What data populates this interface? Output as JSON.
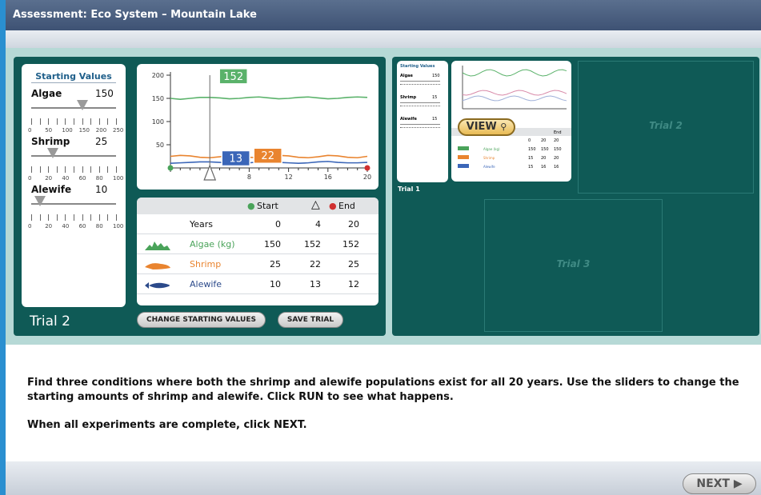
{
  "window": {
    "title": "Assessment: Eco System – Mountain Lake"
  },
  "starting_values": {
    "title": "Starting Values",
    "sliders": [
      {
        "label": "Algae",
        "value": "150",
        "ticks": [
          "0",
          "50",
          "100",
          "150",
          "200",
          "250"
        ],
        "fraction": 0.6
      },
      {
        "label": "Shrimp",
        "value": "25",
        "ticks": [
          "0",
          "20",
          "40",
          "60",
          "80",
          "100"
        ],
        "fraction": 0.25
      },
      {
        "label": "Alewife",
        "value": "10",
        "ticks": [
          "0",
          "20",
          "40",
          "60",
          "80",
          "100"
        ],
        "fraction": 0.1
      }
    ]
  },
  "trial_label": "Trial 2",
  "chart_data": {
    "type": "line",
    "x_ticks": [
      "4",
      "8",
      "12",
      "16",
      "20"
    ],
    "y_ticks": [
      "50",
      "100",
      "150",
      "200"
    ],
    "ylim": [
      0,
      200
    ],
    "xlim": [
      0,
      20
    ],
    "marker_labels": {
      "algae": "152",
      "shrimp": "22",
      "alewife": "13"
    },
    "marker_year": 4,
    "series": [
      {
        "color": "#5ab26a",
        "x": [
          0,
          1,
          2,
          3,
          4,
          5,
          6,
          7,
          8,
          9,
          10,
          11,
          12,
          13,
          14,
          15,
          16,
          17,
          18,
          19,
          20
        ],
        "y": [
          150,
          148,
          150,
          152,
          152,
          151,
          149,
          150,
          152,
          153,
          151,
          149,
          150,
          152,
          153,
          151,
          149,
          150,
          152,
          153,
          152
        ]
      },
      {
        "color": "#e9842f",
        "x": [
          0,
          1,
          2,
          3,
          4,
          5,
          6,
          7,
          8,
          9,
          10,
          11,
          12,
          13,
          14,
          15,
          16,
          17,
          18,
          19,
          20
        ],
        "y": [
          25,
          27,
          26,
          23,
          22,
          24,
          27,
          26,
          23,
          22,
          24,
          27,
          26,
          23,
          22,
          24,
          27,
          26,
          23,
          22,
          25
        ]
      },
      {
        "color": "#3b66b8",
        "x": [
          0,
          1,
          2,
          3,
          4,
          5,
          6,
          7,
          8,
          9,
          10,
          11,
          12,
          13,
          14,
          15,
          16,
          17,
          18,
          19,
          20
        ],
        "y": [
          10,
          11,
          12,
          13,
          13,
          12,
          11,
          10,
          11,
          13,
          14,
          12,
          11,
          10,
          11,
          13,
          14,
          12,
          11,
          11,
          12
        ]
      }
    ]
  },
  "table": {
    "header": {
      "start": "Start",
      "end": "End"
    },
    "years_label": "Years",
    "years": [
      "0",
      "4",
      "20"
    ],
    "rows": [
      {
        "name": "Algae (kg)",
        "color": "#4aa35a",
        "icon": "algae-icon",
        "values": [
          "150",
          "152",
          "152"
        ]
      },
      {
        "name": "Shrimp",
        "color": "#e9842f",
        "icon": "shrimp-icon",
        "values": [
          "25",
          "22",
          "25"
        ]
      },
      {
        "name": "Alewife",
        "color": "#2c4a8a",
        "icon": "fish-icon",
        "values": [
          "10",
          "13",
          "12"
        ]
      }
    ]
  },
  "buttons": {
    "change": "CHANGE STARTING VALUES",
    "save": "SAVE TRIAL",
    "next": "NEXT",
    "view": "VIEW"
  },
  "trials": {
    "trial1": {
      "label": "Trial 1"
    },
    "trial2": {
      "label": "Trial 2"
    },
    "trial3": {
      "label": "Trial 3"
    }
  },
  "thumbnail": {
    "title": "Starting Values",
    "rows": [
      {
        "label": "Algae",
        "value": "150"
      },
      {
        "label": "Shrimp",
        "value": "15"
      },
      {
        "label": "Alewife",
        "value": "15"
      }
    ],
    "table_header": {
      "end": "End"
    },
    "years": [
      "0",
      "20",
      "20"
    ],
    "table_rows": [
      {
        "name": "Algae (kg)",
        "values": [
          "150",
          "150",
          "150"
        ]
      },
      {
        "name": "Shrimp",
        "values": [
          "15",
          "20",
          "20"
        ]
      },
      {
        "name": "Alewife",
        "values": [
          "15",
          "16",
          "16"
        ]
      }
    ]
  },
  "instructions": {
    "line1": "Find three conditions where both the shrimp and alewife populations exist for all 20 years. Use the sliders to change the starting amounts of shrimp and alewife. Click RUN to see what happens.",
    "line2": "When all experiments are complete, click NEXT."
  }
}
